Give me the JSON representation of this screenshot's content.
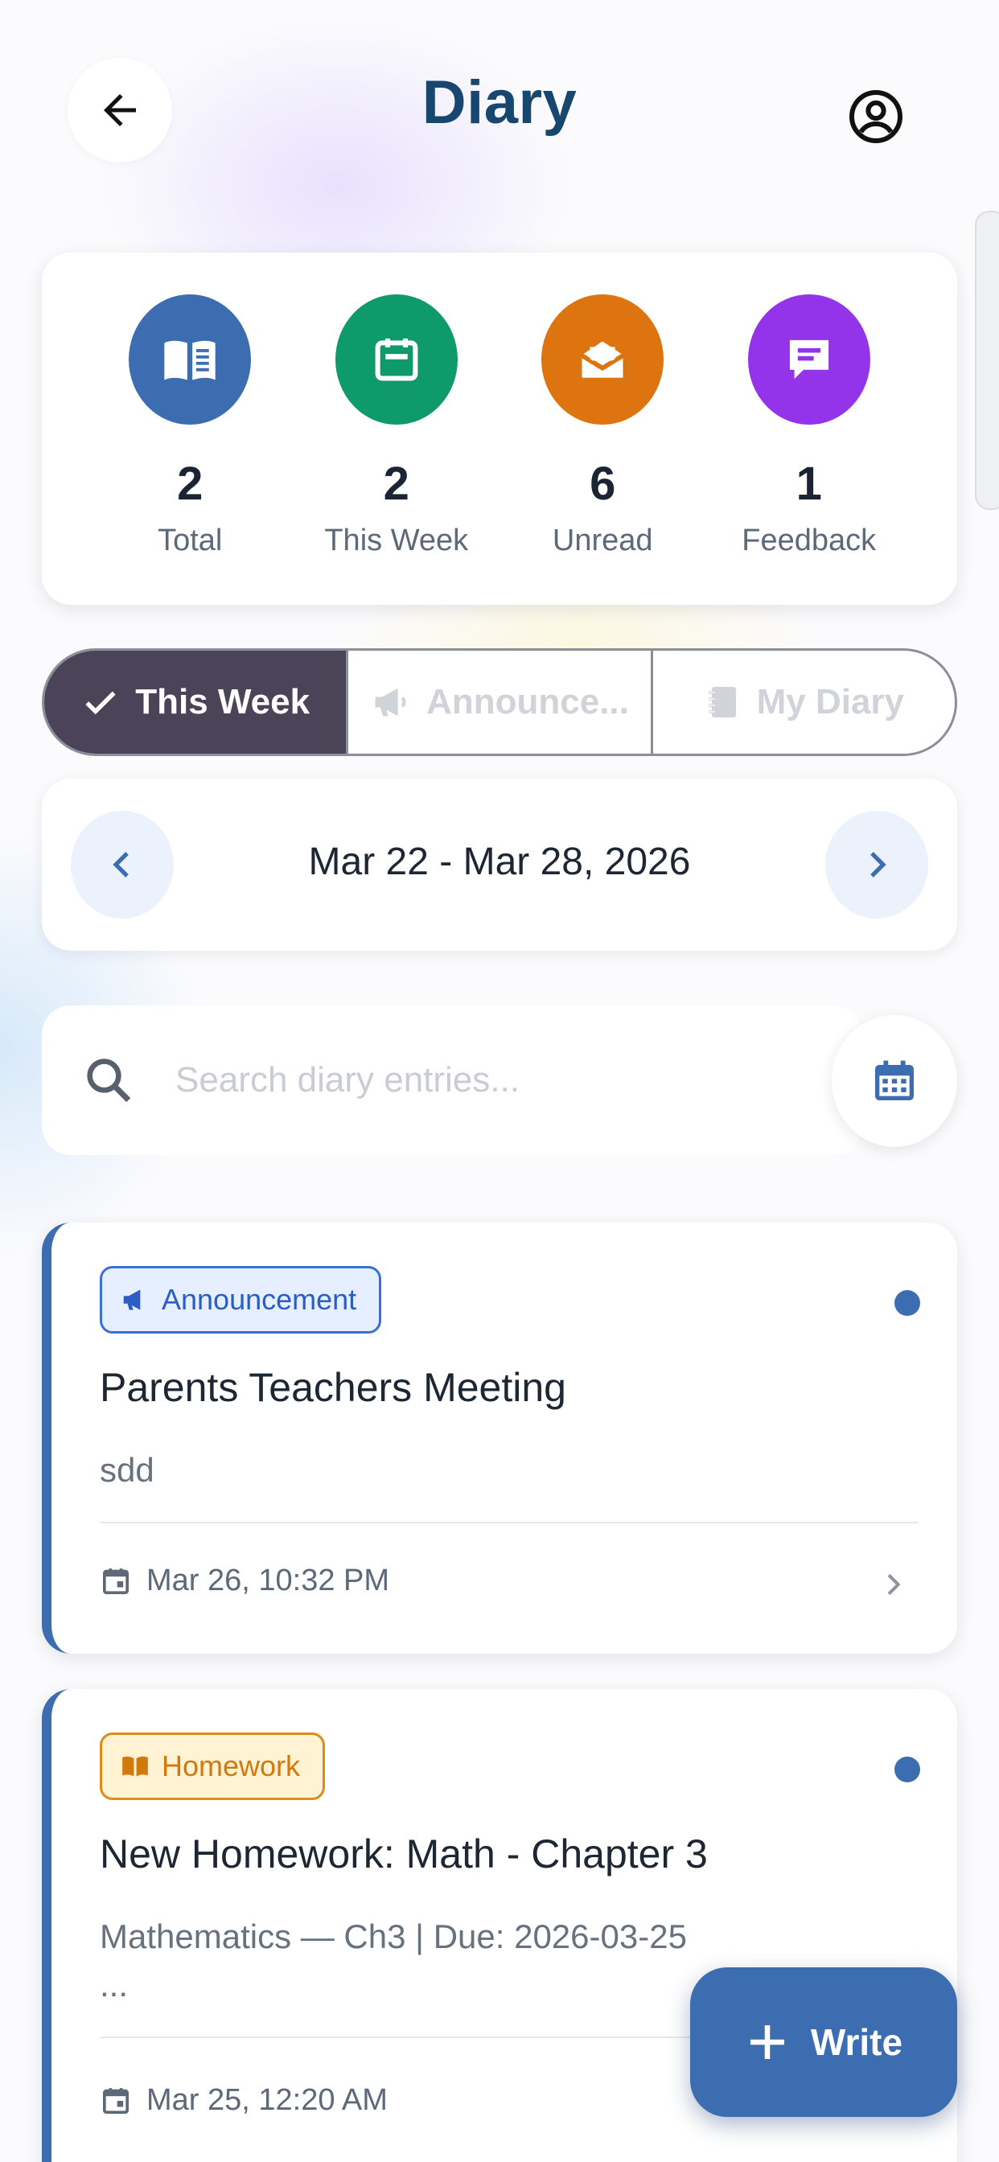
{
  "header": {
    "title": "Diary",
    "back_icon": "arrow-left-icon",
    "profile_icon": "account-circle-icon"
  },
  "stats": [
    {
      "value": "2",
      "label": "Total",
      "color": "#3b6db0",
      "icon": "book-icon"
    },
    {
      "value": "2",
      "label": "This Week",
      "color": "#0f9a6c",
      "icon": "calendar-icon"
    },
    {
      "value": "6",
      "label": "Unread",
      "color": "#dd7410",
      "icon": "envelope-open-icon"
    },
    {
      "value": "1",
      "label": "Feedback",
      "color": "#9333ea",
      "icon": "comment-icon"
    }
  ],
  "tabs": [
    {
      "label": "This Week",
      "active": true,
      "icon": "check-icon"
    },
    {
      "label": "Announce...",
      "active": false,
      "icon": "megaphone-icon"
    },
    {
      "label": "My Diary",
      "active": false,
      "icon": "notebook-icon"
    }
  ],
  "week_nav": {
    "range": "Mar 22 - Mar 28, 2026"
  },
  "search": {
    "placeholder": "Search diary entries...",
    "value": ""
  },
  "entries": [
    {
      "type": "Announcement",
      "title": "Parents Teachers Meeting",
      "snippet": "sdd",
      "date": "Mar 26, 10:32 PM",
      "unread": true
    },
    {
      "type": "Homework",
      "title": "New Homework: Math - Chapter 3",
      "snippet": "Mathematics — Ch3 | Due: 2026-03-25",
      "snippet_more": "...",
      "date": "Mar 25, 12:20 AM",
      "unread": true
    }
  ],
  "fab": {
    "label": "Write"
  },
  "colors": {
    "primary": "#3b6db0",
    "title": "#17466e",
    "tab_active": "#4b4458"
  }
}
